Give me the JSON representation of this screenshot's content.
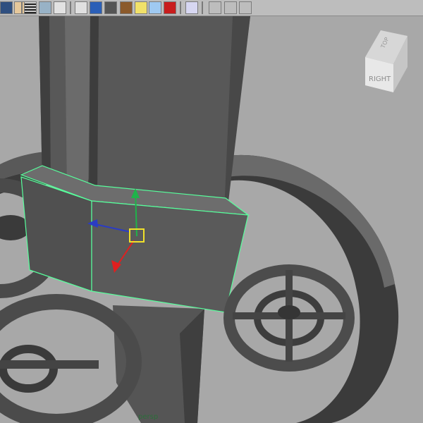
{
  "toolbar": {
    "icons": [
      "select-cube-icon",
      "sphere-icon",
      "grid-icon",
      "uv-texture-icon",
      "text-tool-icon",
      "wireframe-cube-icon",
      "shaded-cube-icon",
      "smooth-shaded-icon",
      "texture-checker-icon",
      "light-bulb-icon",
      "xray-cube-icon",
      "isolate-red-cube-icon",
      "frame-selection-icon",
      "frame-all-icon",
      "film-gate-icon",
      "resolution-gate-icon",
      "measure-tool-icon"
    ]
  },
  "viewcube": {
    "top_label": "TOP",
    "right_label": "RIGHT"
  },
  "viewport": {
    "status_text": "persp"
  },
  "colors": {
    "background": "#a8a8a8",
    "mesh_dark": "#4a4a4a",
    "mesh_mid": "#5c5c5c",
    "mesh_light": "#6e6e6e",
    "selection_green": "#57ff9c",
    "manip_x": "#e01f1f",
    "manip_y": "#1fb34a",
    "manip_z": "#2b3cc4",
    "manip_center": "#f1e12a"
  }
}
